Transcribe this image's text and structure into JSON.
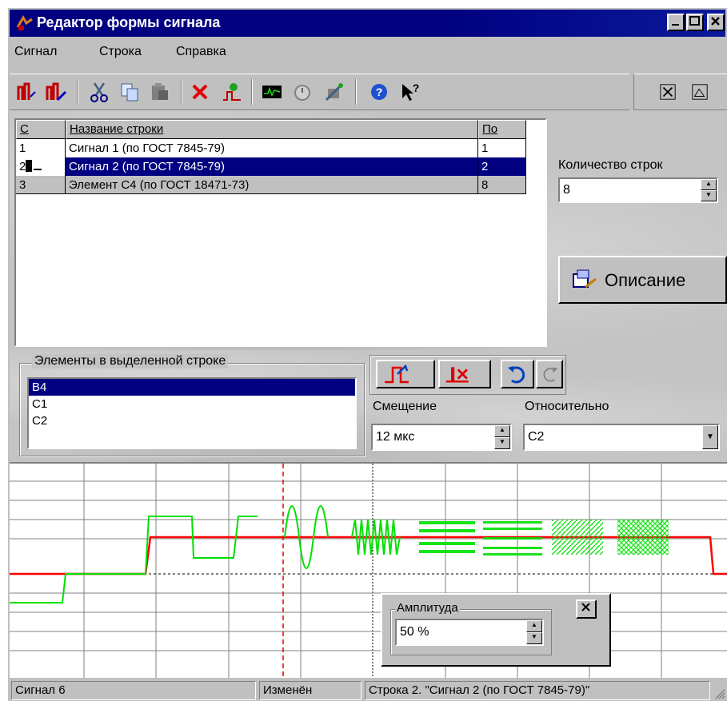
{
  "window": {
    "title": "Редактор формы сигнала",
    "controls": [
      "_",
      "□",
      "×"
    ]
  },
  "menu": [
    "Сигнал",
    "Строка",
    "Справка"
  ],
  "table": {
    "headers": [
      "С",
      "Название строки",
      "По"
    ],
    "rows": [
      {
        "c": "1",
        "name": "Сигнал 1 (по ГОСТ 7845-79)",
        "po": "1"
      },
      {
        "c": "2",
        "name": "Сигнал 2 (по ГОСТ 7845-79)",
        "po": "2"
      },
      {
        "c": "3",
        "name": "Элемент С4 (по ГОСТ 18471-73)",
        "po": "8"
      }
    ]
  },
  "rows_count": {
    "label": "Количество строк",
    "value": "8"
  },
  "description_button": "Описание",
  "elements": {
    "label": "Элементы в выделенной строке",
    "items": [
      "B4",
      "C1",
      "C2"
    ]
  },
  "offset": {
    "label": "Смещение",
    "value": "12 мкс"
  },
  "relative": {
    "label": "Относительно",
    "value": "C2"
  },
  "amplitude": {
    "label": "Амплитуда",
    "value": "50 %"
  },
  "status": {
    "signal": "Сигнал 6",
    "state": "Изменён",
    "row": "Строка 2. \"Сигнал 2 (по ГОСТ 7845-79)\""
  },
  "colors": {
    "titlebar": "#000080",
    "selection": "#000080",
    "trace_green": "#00dd00",
    "trace_red": "#ff0000",
    "face": "#c0c0c0"
  }
}
